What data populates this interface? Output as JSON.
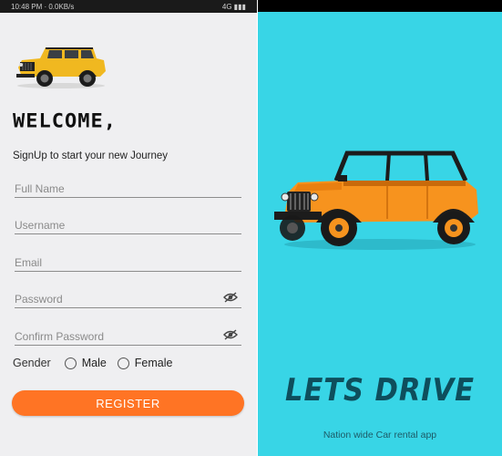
{
  "statusbar": {
    "left_text": "10:48 PM  ·  0.0KB/s",
    "right_text": "4G  ▮▮▮"
  },
  "signup": {
    "welcome_title": "WELCOME,",
    "subtitle": "SignUp to start your new Journey",
    "fields": {
      "full_name_placeholder": "Full Name",
      "username_placeholder": "Username",
      "email_placeholder": "Email",
      "password_placeholder": "Password",
      "confirm_password_placeholder": "Confirm Password"
    },
    "gender": {
      "label": "Gender",
      "options": [
        "Male",
        "Female"
      ]
    },
    "register_label": "REGISTER"
  },
  "splash": {
    "brand": "LETS DRIVE",
    "tagline": "Nation wide Car rental app"
  },
  "colors": {
    "accent": "#ff7424",
    "splash_background": "#38d5e6",
    "brand_text": "#0e4e5c",
    "signup_background": "#efeff1"
  },
  "icons": {
    "password_toggle": "eye-off-icon",
    "logo": "yellow-jeep-logo",
    "hero": "orange-jeep-illustration"
  }
}
